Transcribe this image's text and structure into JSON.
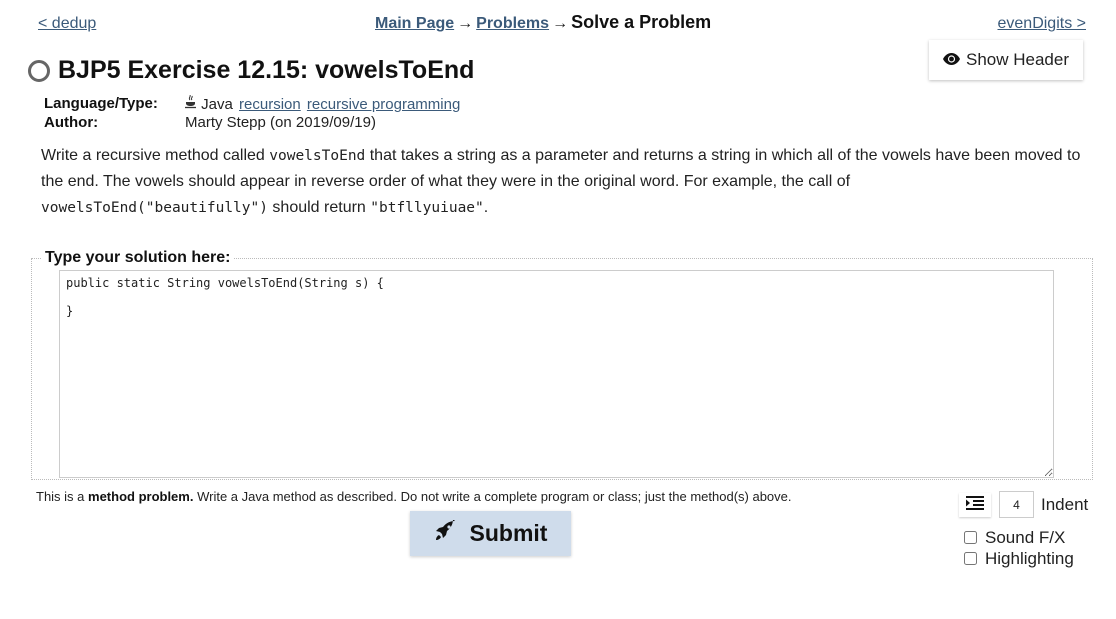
{
  "nav": {
    "prev_label": "< dedup",
    "next_label": "evenDigits >",
    "breadcrumb": {
      "main_page": "Main Page",
      "separator": "→",
      "problems": "Problems",
      "current": "Solve a Problem"
    },
    "show_header_label": "Show Header",
    "show_header_icon": "eye-icon"
  },
  "problem": {
    "title": "BJP5 Exercise 12.15: vowelsToEnd",
    "status_icon": "unsolved-circle-icon",
    "meta": {
      "language_label": "Language/Type:",
      "language_icon": "java-cup-icon",
      "language": "Java",
      "tags": [
        "recursion",
        "recursive programming"
      ],
      "author_label": "Author:",
      "author": "Marty Stepp (on 2019/09/19)"
    },
    "description": {
      "part1": "Write a recursive method called ",
      "code1": "vowelsToEnd",
      "part2": " that takes a string as a parameter and returns a string in which all of the vowels have been moved to the end. The vowels should appear in reverse order of what they were in the original word. For example, the call of ",
      "code2": "vowelsToEnd(\"beautifully\")",
      "part3": " should return ",
      "code3": "\"btfllyuiuae\"",
      "part4": "."
    }
  },
  "solution": {
    "legend": "Type your solution here:",
    "code": "public static String vowelsToEnd(String s) {\n\n}"
  },
  "hint": {
    "prefix": "This is a ",
    "bold": "method problem.",
    "suffix": " Write a Java method as described. Do not write a complete program or class; just the method(s) above."
  },
  "submit": {
    "label": "Submit",
    "icon": "rocket-icon",
    "bg_color": "#cfdceb"
  },
  "settings": {
    "indent_icon": "indent-icon",
    "indent_value": "4",
    "indent_label": "Indent",
    "sound_label": "Sound F/X",
    "sound_checked": false,
    "highlighting_label": "Highlighting",
    "highlighting_checked": false
  }
}
